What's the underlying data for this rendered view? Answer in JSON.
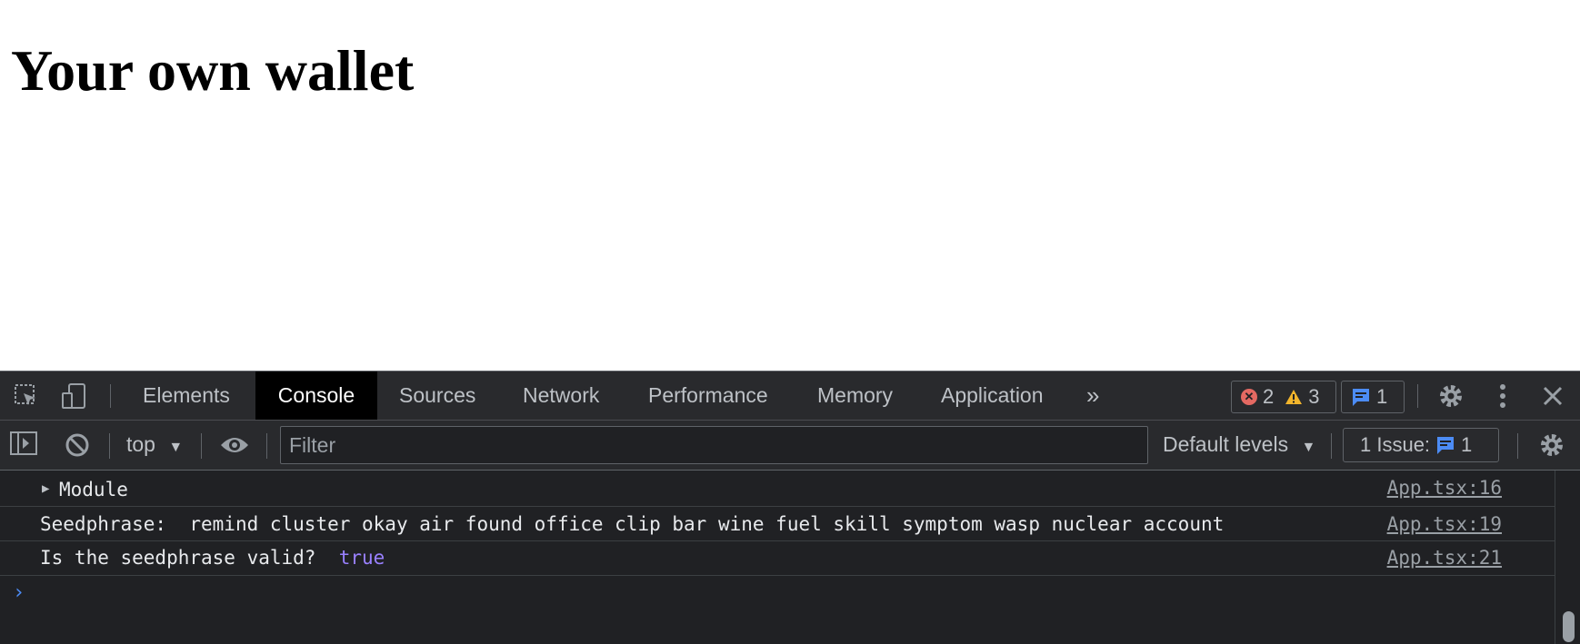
{
  "page": {
    "heading": "Your own wallet"
  },
  "devtools": {
    "tabs": [
      "Elements",
      "Console",
      "Sources",
      "Network",
      "Performance",
      "Memory",
      "Application"
    ],
    "more_tabs_glyph": "»",
    "status": {
      "errors": "2",
      "warnings": "3",
      "messages": "1"
    },
    "console_toolbar": {
      "context": "top",
      "filter_placeholder": "Filter",
      "levels": "Default levels",
      "issues_label": "1 Issue:",
      "issues_count": "1"
    },
    "messages": [
      {
        "text": "Module",
        "source": "App.tsx:16"
      },
      {
        "label": "Seedphrase: ",
        "value": "remind cluster okay air found office clip bar wine fuel skill symptom wasp nuclear account",
        "source": "App.tsx:19"
      },
      {
        "label": "Is the seedphrase valid? ",
        "value": "true",
        "source": "App.tsx:21"
      }
    ],
    "prompt_glyph": "›"
  }
}
